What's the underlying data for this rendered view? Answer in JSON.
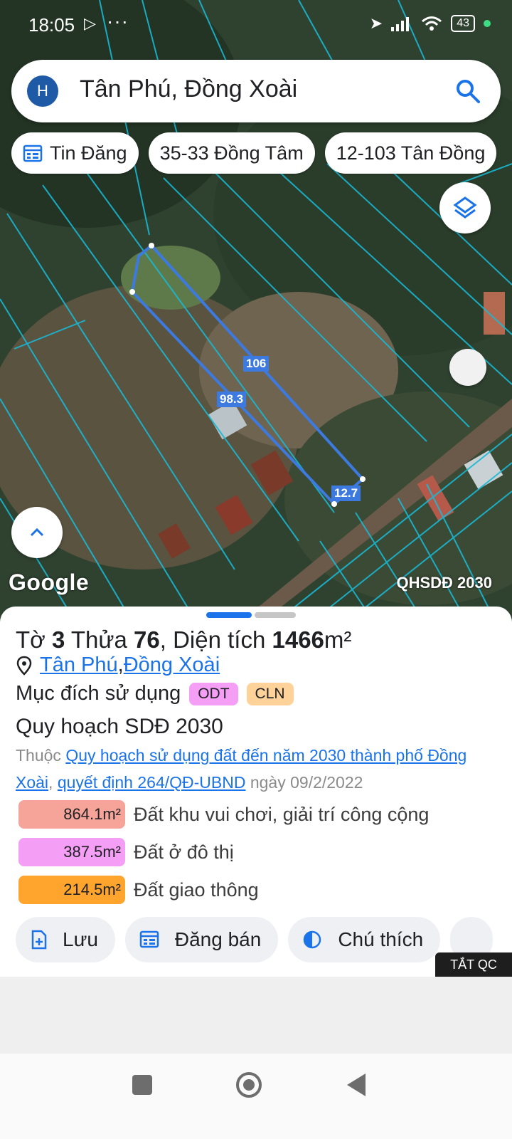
{
  "status_bar": {
    "time": "18:05",
    "battery": "43"
  },
  "search": {
    "avatar_letter": "H",
    "query": "Tân Phú, Đồng Xoài"
  },
  "chips": [
    {
      "label": "Tin Đăng"
    },
    {
      "label": "35-33 Đồng Tâm"
    },
    {
      "label": "12-103 Tân Đồng"
    }
  ],
  "map": {
    "logo": "Google",
    "overlay_label": "QHSDĐ 2030",
    "measurements": [
      "106",
      "98.3",
      "12.7"
    ]
  },
  "parcel": {
    "sheet_prefix": "Tờ ",
    "sheet_no": "3",
    "plot_prefix": " Thửa ",
    "plot_no": "76",
    "area_prefix": ", Diện tích ",
    "area_value": "1466",
    "area_unit": "m²",
    "ward": "Tân Phú",
    "separator": ", ",
    "city": "Đồng Xoài",
    "purpose_label": "Mục đích sử dụng",
    "purpose_tags": [
      {
        "code": "ODT",
        "color": "#f49ef5"
      },
      {
        "code": "CLN",
        "color": "#ffd29a"
      }
    ],
    "plan_title": "Quy hoạch SDĐ 2030",
    "desc_prefix": "Thuộc ",
    "desc_link1": "Quy hoạch sử dụng đất đến năm 2030 thành phố Đồng Xoài",
    "desc_sep": ", ",
    "desc_link2": "quyết định 264/QĐ-UBND",
    "desc_suffix": " ngày 09/2/2022"
  },
  "areas": [
    {
      "value": "864.1m²",
      "label": "Đất khu vui chơi, giải trí công cộng",
      "color": "#f6a39a"
    },
    {
      "value": "387.5m²",
      "label": "Đất ở đô thị",
      "color": "#f49ef5"
    },
    {
      "value": "214.5m²",
      "label": "Đất giao thông",
      "color": "#ffa52e"
    }
  ],
  "actions": {
    "save": "Lưu",
    "post": "Đăng bán",
    "legend": "Chú thích"
  },
  "ads": {
    "label": "TẮT QC"
  },
  "colors": {
    "accent": "#1a73e8",
    "parcel_outline": "#3d7ae0",
    "map_lines": "#19b8d4"
  }
}
